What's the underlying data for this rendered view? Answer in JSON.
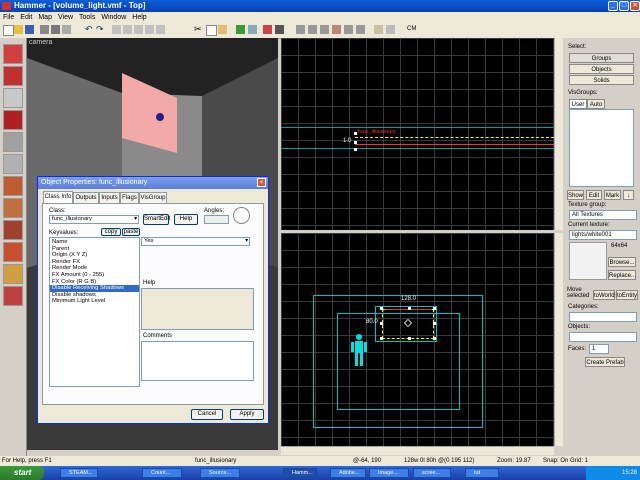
{
  "window": {
    "title": "Hammer - [volume_light.vmf - Top]"
  },
  "menu": [
    "File",
    "Edit",
    "Map",
    "View",
    "Tools",
    "Window",
    "Help"
  ],
  "toolbar": {
    "cm_label": "CM"
  },
  "camera": {
    "label": "camera"
  },
  "top_view": {
    "entity_label": "func_illusionary",
    "dimension": "1.0"
  },
  "side_view": {
    "width_label": "128.0",
    "height_label": "80.0"
  },
  "right_panel": {
    "select_label": "Select:",
    "groups": "Groups",
    "objects": "Objects",
    "solids": "Solids",
    "visgroups_label": "VisGroups:",
    "tab_user": "User",
    "tab_auto": "Auto",
    "show": "Show",
    "edit": "Edit",
    "mark": "Mark",
    "texture_group_label": "Texture group:",
    "texture_group_value": "All Textures",
    "current_texture_label": "Current texture:",
    "current_texture_value": "lights/white001",
    "texture_size": "64x64",
    "browse": "Browse...",
    "replace": "Replace...",
    "move_selected": "Move selected",
    "to_world": "toWorld",
    "to_entity": "toEntity",
    "categories_label": "Categories:",
    "objects_label": "Objects:",
    "faces_label": "Faces:",
    "faces_value": "1",
    "create_prefab": "Create Prefab"
  },
  "dialog": {
    "title": "Object Properties: func_illusionary",
    "tabs": [
      "Class Info",
      "Outputs",
      "Inputs",
      "Flags",
      "VisGroup"
    ],
    "class_label": "Class:",
    "class_value": "func_illusionary",
    "smartedit": "SmartEdit",
    "help_button": "Help",
    "angles_label": "Angles:",
    "keyvalues_label": "Keyvalues:",
    "copy": "copy",
    "paste": "paste",
    "keyvalues": [
      "Name",
      "Parent",
      "Origin (X Y Z)",
      "Render FX",
      "Render Mode",
      "FX Amount (0 - 255)",
      "FX Color (R G B)",
      "Disable Receiving Shadows",
      "Disable shadows",
      "Minimum Light Level"
    ],
    "selected_index": 7,
    "value_selected": "Yes",
    "help_label": "Help",
    "comments_label": "Comments",
    "cancel": "Cancel",
    "apply": "Apply"
  },
  "status": {
    "help": "For Help, press F1",
    "selection": "func_illusionary",
    "coords": "@-64, 190",
    "size": "128w 0l 80h @(0 195 112)",
    "zoom": "Zoom: 19.87",
    "snap": "Snap: On Grid: 1"
  },
  "taskbar": {
    "start": "start",
    "tasks": [
      "STEAM...",
      "Count...",
      "Source...",
      "Hamm...",
      "Adobe...",
      "Image...",
      "scree...",
      "tut"
    ],
    "active_index": 3,
    "clock": "15:28"
  },
  "colors": {
    "xp_blue": "#0a5fd8",
    "selection_yellow": "#ffff00",
    "entity_red": "#ff3030",
    "grid_cyan": "#00c0c0",
    "camera_pink": "#f4a9a9"
  }
}
